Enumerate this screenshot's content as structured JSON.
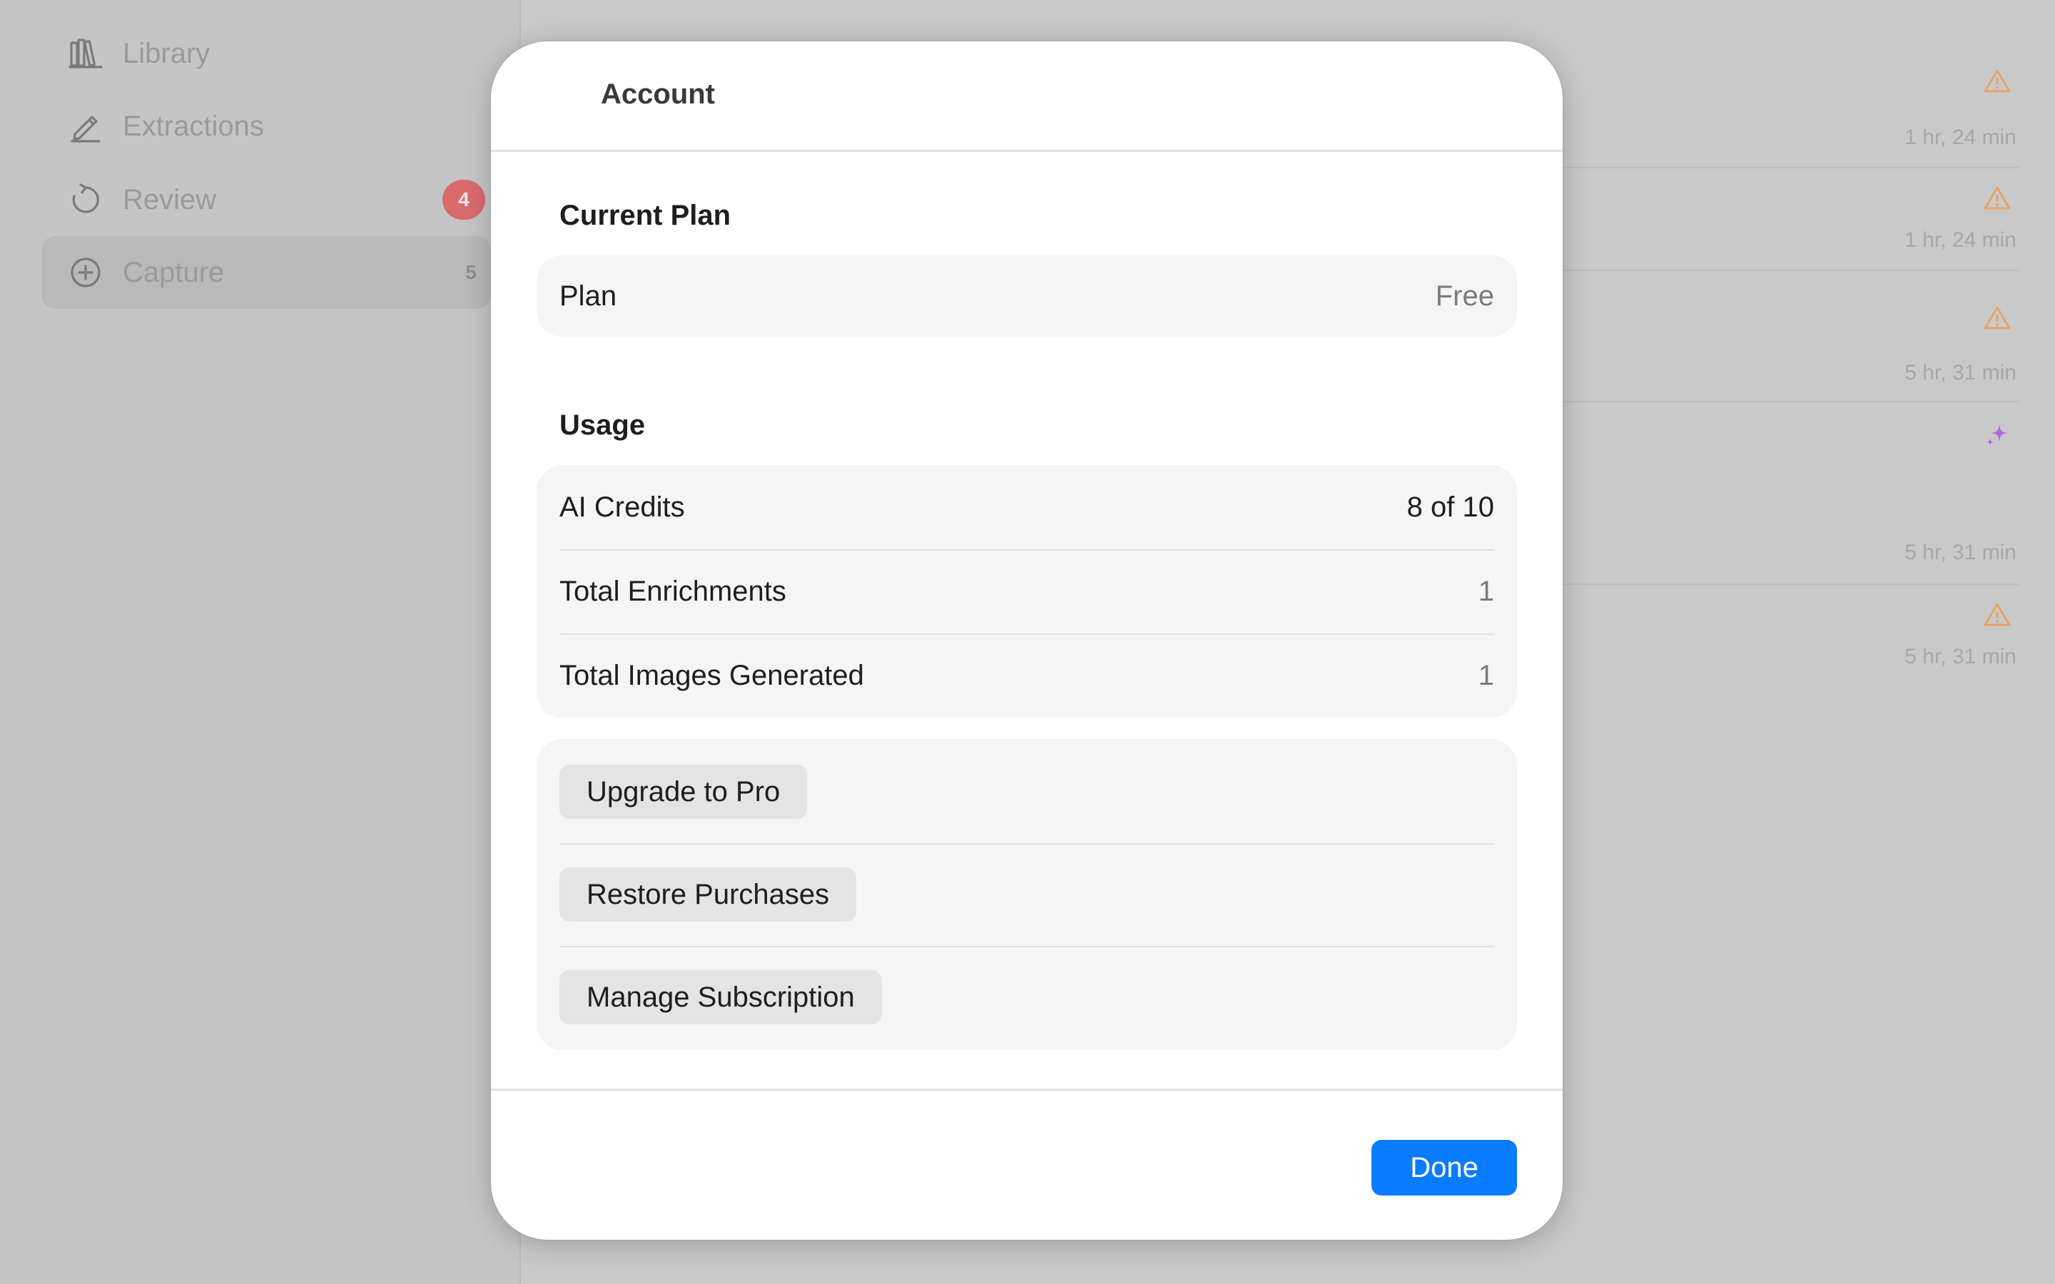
{
  "sidebar": {
    "items": [
      {
        "label": "Library",
        "icon": "books-icon"
      },
      {
        "label": "Extractions",
        "icon": "pencil-icon"
      },
      {
        "label": "Review",
        "icon": "refresh-icon",
        "badge": "4"
      },
      {
        "label": "Capture",
        "icon": "plus-circle-icon",
        "badge": "5"
      }
    ]
  },
  "background_list": {
    "rows": [
      {
        "icon": "warning-icon",
        "time": "1 hr, 24 min"
      },
      {
        "icon": "warning-icon",
        "time": "1 hr, 24 min"
      },
      {
        "icon": "warning-icon",
        "time": "5 hr, 31 min"
      },
      {
        "icon": "sparkle-icon",
        "time": "5 hr, 31 min"
      },
      {
        "icon": "warning-icon",
        "time": "5 hr, 31 min"
      }
    ]
  },
  "sheet": {
    "title": "Account",
    "current_plan": {
      "heading": "Current Plan",
      "plan_label": "Plan",
      "plan_value": "Free"
    },
    "usage": {
      "heading": "Usage",
      "rows": [
        {
          "label": "AI Credits",
          "value": "8 of 10"
        },
        {
          "label": "Total Enrichments",
          "value": "1"
        },
        {
          "label": "Total Images Generated",
          "value": "1"
        }
      ]
    },
    "actions": {
      "upgrade": "Upgrade to Pro",
      "restore": "Restore Purchases",
      "manage": "Manage Subscription"
    },
    "done_label": "Done"
  },
  "colors": {
    "accent": "#0a7cff",
    "badge_red": "#d96b6d",
    "warning": "#e6a36a",
    "sparkle": "#b567d9"
  }
}
